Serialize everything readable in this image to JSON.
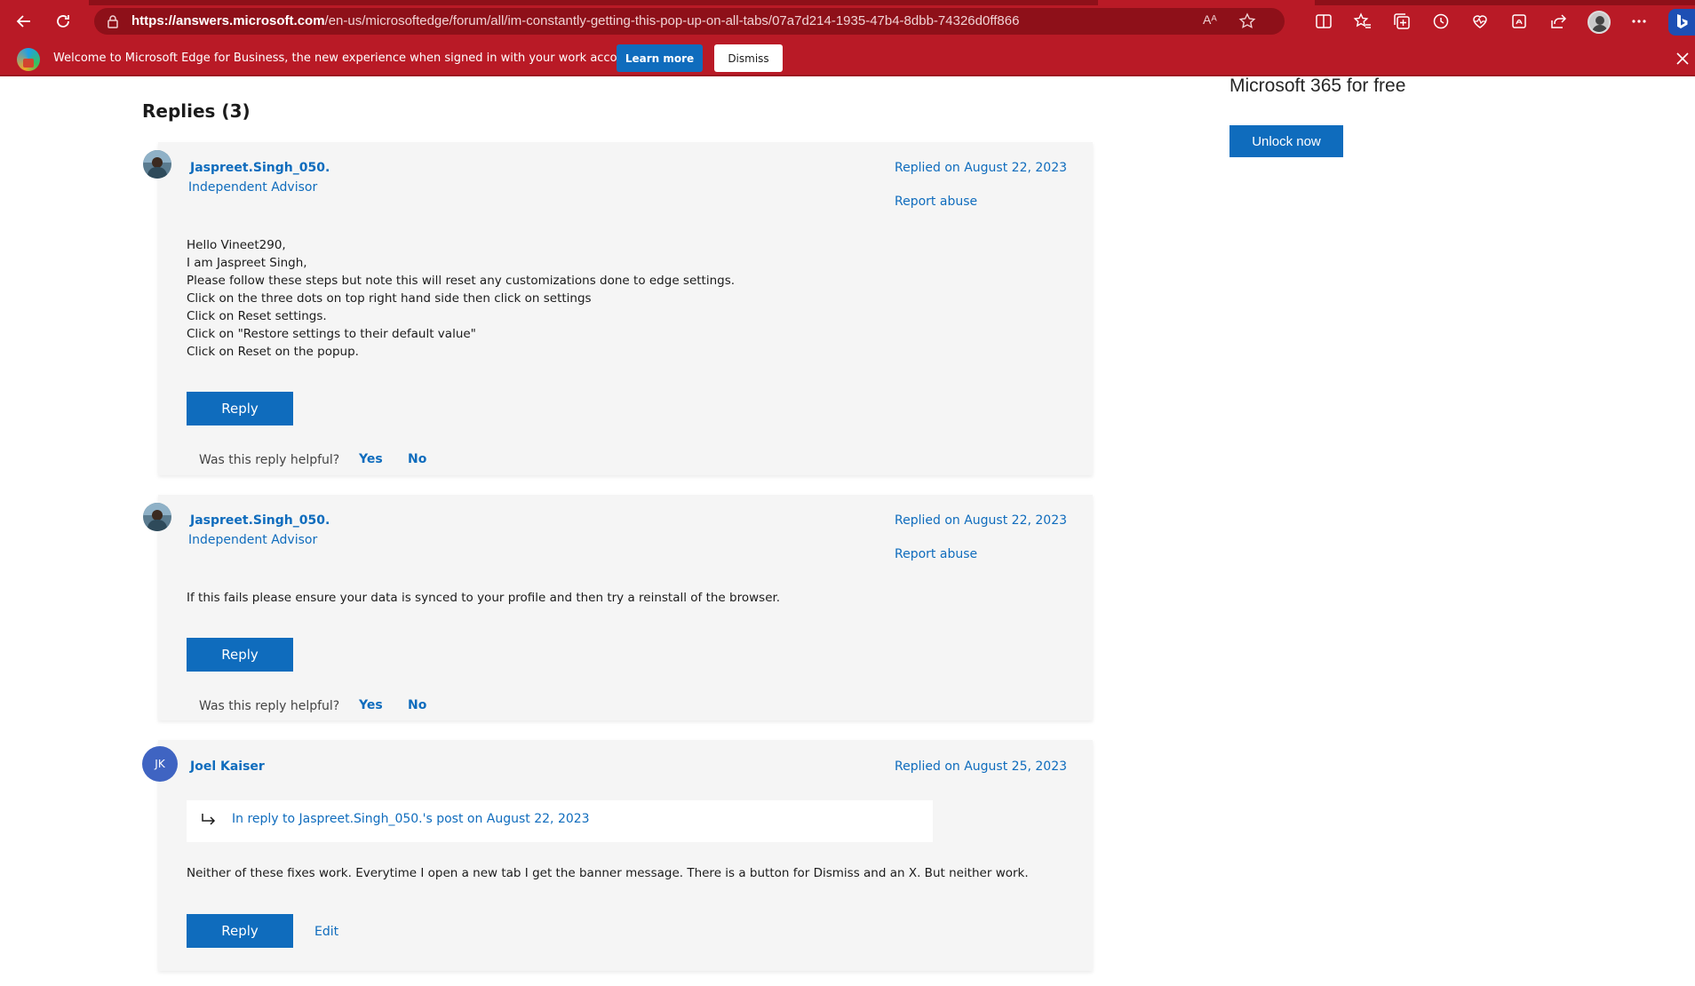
{
  "browser": {
    "url_host": "https://answers.microsoft.com",
    "url_path": "/en-us/microsoftedge/forum/all/im-constantly-getting-this-pop-up-on-all-tabs/07a7d214-1935-47b4-8dbb-74326d0ff866",
    "read_aloud_label": "Aᴬ"
  },
  "infobar": {
    "message": "Welcome to Microsoft Edge for Business, the new experience when signed in with your work account.",
    "learn_more": "Learn more",
    "dismiss": "Dismiss"
  },
  "promo": {
    "title": "Microsoft 365 for free",
    "unlock_label": "Unlock now"
  },
  "replies_title": "Replies (3)",
  "replies": [
    {
      "author": "Jaspreet.Singh_050.",
      "role": "Independent Advisor",
      "date": "Replied on August 22, 2023",
      "report": "Report abuse",
      "lines": [
        "Hello Vineet290,",
        "I am Jaspreet Singh,",
        "Please follow these steps but note this will reset any customizations done to edge settings.",
        "Click on the three dots on top right hand side then click on settings",
        "Click on Reset settings.",
        "Click on \"Restore settings to their default value\"",
        "Click on Reset on the popup."
      ],
      "reply_label": "Reply",
      "helpful_q": "Was this reply helpful?",
      "yes": "Yes",
      "no": "No"
    },
    {
      "author": "Jaspreet.Singh_050.",
      "role": "Independent Advisor",
      "date": "Replied on August 22, 2023",
      "report": "Report abuse",
      "lines": [
        "If this fails please ensure your data is synced to your profile and then try a reinstall of the browser."
      ],
      "reply_label": "Reply",
      "helpful_q": "Was this reply helpful?",
      "yes": "Yes",
      "no": "No"
    },
    {
      "author": "Joel Kaiser",
      "initials": "JK",
      "date": "Replied on August 25, 2023",
      "in_reply_to": "In reply to Jaspreet.Singh_050.'s post on August 22, 2023",
      "lines": [
        "Neither of these fixes work. Everytime I open a new tab I get the banner message. There is a button for Dismiss and an X. But neither work."
      ],
      "reply_label": "Reply",
      "edit_label": "Edit"
    }
  ],
  "colors": {
    "browser_frame": "#b91a26",
    "link_blue": "#0f6cbd",
    "card_bg": "#f5f5f5"
  }
}
